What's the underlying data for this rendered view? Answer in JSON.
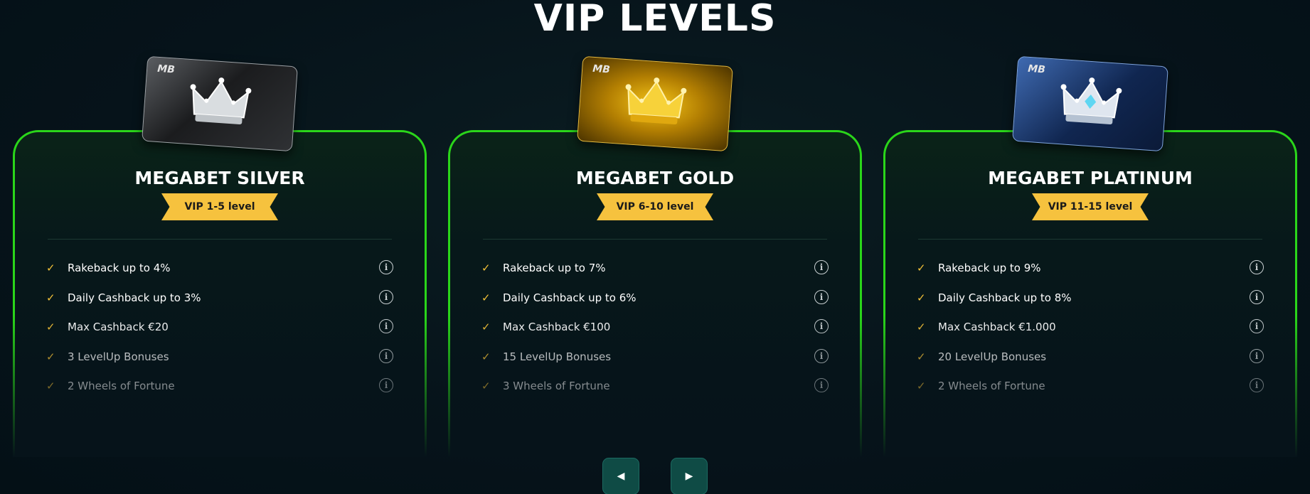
{
  "page": {
    "title": "VIP LEVELS"
  },
  "cards": [
    {
      "card_logo": "MB",
      "name": "MEGABET SILVER",
      "level": "VIP 1-5 level",
      "perks": [
        "Rakeback up to 4%",
        "Daily Cashback up to 3%",
        "Max Cashback €20",
        "3 LevelUp Bonuses",
        "2 Wheels of Fortune"
      ]
    },
    {
      "card_logo": "MB",
      "name": "MEGABET GOLD",
      "level": "VIP 6-10 level",
      "perks": [
        "Rakeback up to 7%",
        "Daily Cashback up to 6%",
        "Max Cashback €100",
        "15 LevelUp Bonuses",
        "3 Wheels of Fortune"
      ]
    },
    {
      "card_logo": "MB",
      "name": "MEGABET PLATINUM",
      "level": "VIP 11-15 level",
      "perks": [
        "Rakeback up to 9%",
        "Daily Cashback up to 8%",
        "Max Cashback €1.000",
        "20 LevelUp Bonuses",
        "2 Wheels of Fortune"
      ]
    }
  ],
  "icons": {
    "check": "check-icon",
    "info": "info-icon",
    "prev": "chevron-left-icon",
    "next": "chevron-right-icon",
    "crown": "crown-icon"
  },
  "colors": {
    "background": "#06131a",
    "card_border": "#2ad61a",
    "ribbon": "#f6c23e",
    "check": "#f2c037",
    "nav_button": "#0f4b45"
  }
}
